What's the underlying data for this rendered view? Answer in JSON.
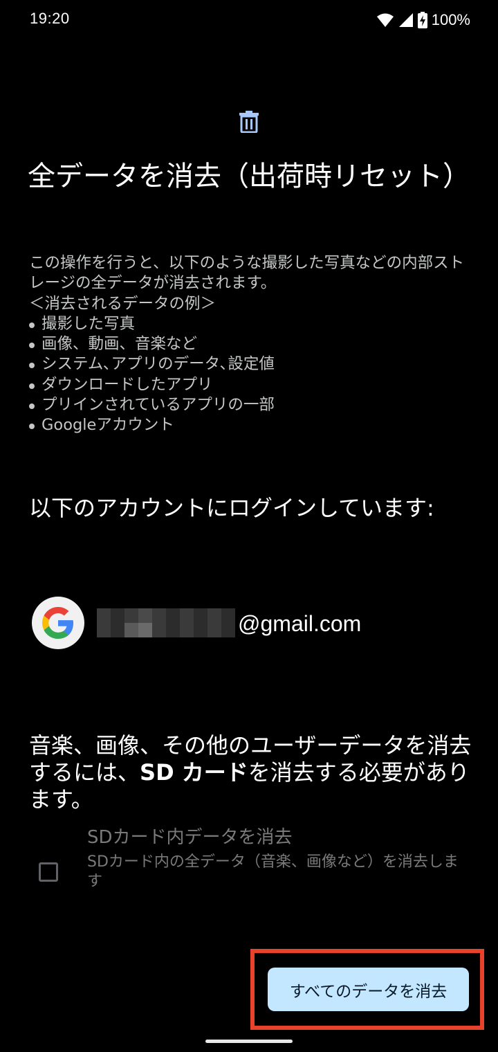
{
  "status_bar": {
    "time": "19:20",
    "battery": "100%",
    "icons": [
      "wifi-icon",
      "cell-signal-icon",
      "battery-charging-icon"
    ]
  },
  "header": {
    "icon": "trash-icon",
    "title": "全データを消去（出荷時リセット）"
  },
  "description": {
    "intro": "この操作を行うと、以下のような撮影した写真などの内部ストレージの全データが消去されます。",
    "examples_heading": "＜消去されるデータの例＞",
    "examples": [
      "撮影した写真",
      "画像、動画、音楽など",
      "システム､アプリのデータ､設定値",
      "ダウンロードしたアプリ",
      "プリインされているアプリの一部",
      "Googleアカウント"
    ]
  },
  "accounts": {
    "heading": "以下のアカウントにログインしています:",
    "items": [
      {
        "icon": "google-logo-icon",
        "email_domain": "@gmail.com"
      }
    ]
  },
  "sd_note": {
    "before": "音楽、画像、その他のユーザーデータを消去するには、",
    "bold": "SD カード",
    "after": "を消去する必要があります。"
  },
  "sd_option": {
    "title": "SDカード内データを消去",
    "description": "SDカード内の全データ（音楽、画像など）を消去します",
    "checked": false
  },
  "action": {
    "erase_label": "すべてのデータを消去"
  },
  "colors": {
    "background": "#000000",
    "button": "#c2e7ff",
    "highlight": "#e8432a",
    "icon_accent": "#a8c7fa"
  }
}
